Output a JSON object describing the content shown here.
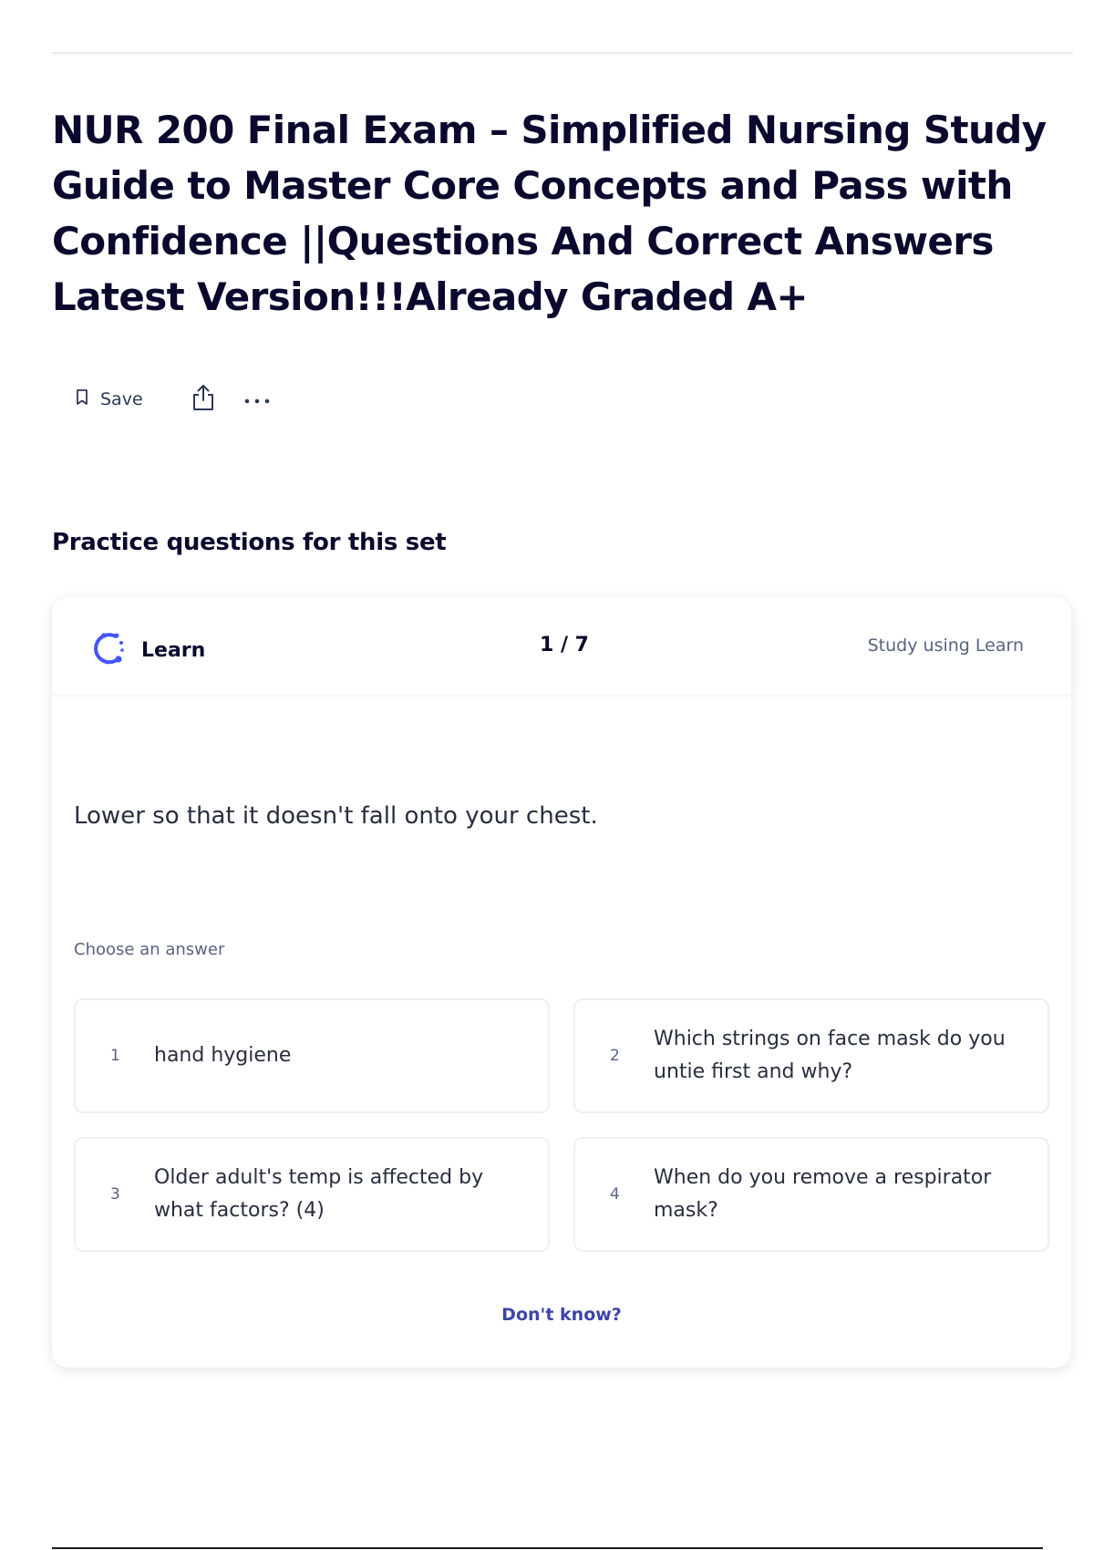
{
  "page": {
    "title": "NUR 200 Final Exam – Simplified Nursing Study Guide to Master Core Concepts and Pass with Confidence ||Questions And Correct Answers Latest Version!!!Already Graded A+"
  },
  "actions": {
    "save_label": "Save",
    "save_icon": "bookmark-icon",
    "share_icon": "share-icon",
    "more_icon": "more-horizontal-icon"
  },
  "practice": {
    "heading": "Practice questions for this set"
  },
  "card": {
    "mode_label": "Learn",
    "mode_icon": "learn-icon",
    "progress": "1 / 7",
    "study_link": "Study using Learn",
    "term": "Lower so that it doesn't fall onto your chest.",
    "prompt": "Choose an answer",
    "options": [
      {
        "number": "1",
        "text": "hand hygiene"
      },
      {
        "number": "2",
        "text": "Which strings on face mask do you untie first and why?"
      },
      {
        "number": "3",
        "text": "Older adult's temp is affected by what factors? (4)"
      },
      {
        "number": "4",
        "text": "When do you remove a respirator mask?"
      }
    ],
    "dont_know": "Don't know?"
  },
  "colors": {
    "accent": "#4255ff",
    "text_primary": "#0a092d",
    "text_secondary": "#586380",
    "option_border": "#edeff4"
  }
}
